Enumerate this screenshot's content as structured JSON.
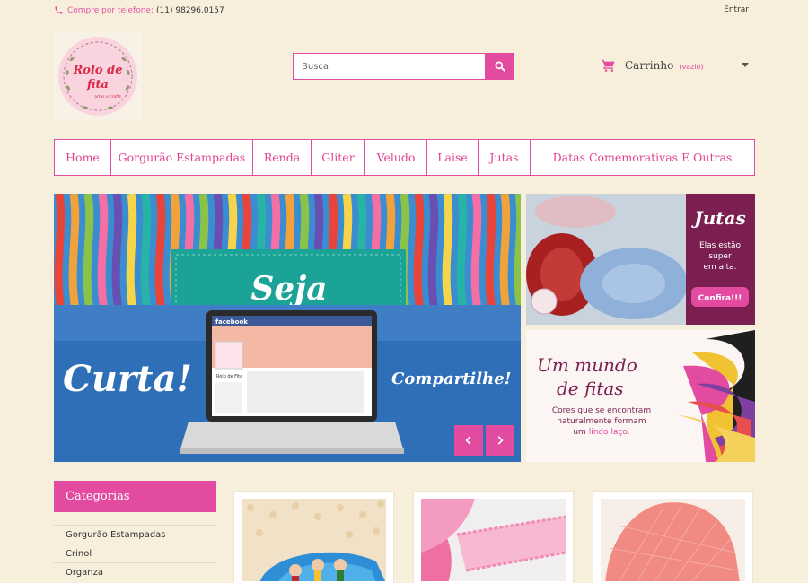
{
  "header": {
    "phone_label": "Compre por telefone:",
    "phone_number": "(11) 98296.0157",
    "login_label": "Entrar"
  },
  "logo": {
    "title_line1": "Rolo de",
    "title_line2": "fita",
    "subtitle": "artes e crafts"
  },
  "search": {
    "placeholder": "Busca"
  },
  "cart": {
    "label": "Carrinho",
    "status": "(vazio)"
  },
  "nav": {
    "items": [
      {
        "label": "Home"
      },
      {
        "label": "Gorgurão Estampadas"
      },
      {
        "label": "Renda"
      },
      {
        "label": "Gliter"
      },
      {
        "label": "Veludo"
      },
      {
        "label": "Laise"
      },
      {
        "label": "Jutas"
      },
      {
        "label": "Datas Comemorativas E Outras"
      }
    ]
  },
  "slider": {
    "headline": "Seja",
    "left_text": "Curta!",
    "right_text": "Compartilhe!",
    "fb_brand": "facebook",
    "fb_page_name": "Rolo de Fita"
  },
  "banner_jutas": {
    "title": "Jutas",
    "line1": "Elas estão",
    "line2": "super",
    "line3": "em alta.",
    "cta": "Confira!!!"
  },
  "banner_fitas": {
    "title_line1": "Um mundo",
    "title_line2": "de fitas",
    "line1": "Cores que se encontram",
    "line2": "naturalmente formam",
    "line3_prefix": "um",
    "line3_highlight": "lindo laço."
  },
  "categories": {
    "title": "Categorias",
    "items": [
      {
        "label": "Gorgurão Estampadas"
      },
      {
        "label": "Crinol"
      },
      {
        "label": "Organza"
      }
    ]
  },
  "colors": {
    "accent": "#e24b9f",
    "background": "#f8eedc",
    "nav_text": "#e2408f",
    "banner_purple": "#7a1f4f"
  },
  "icons": {
    "phone": "phone-icon",
    "search": "search-icon",
    "cart": "cart-icon",
    "prev": "chevron-left-icon",
    "next": "chevron-right-icon"
  }
}
